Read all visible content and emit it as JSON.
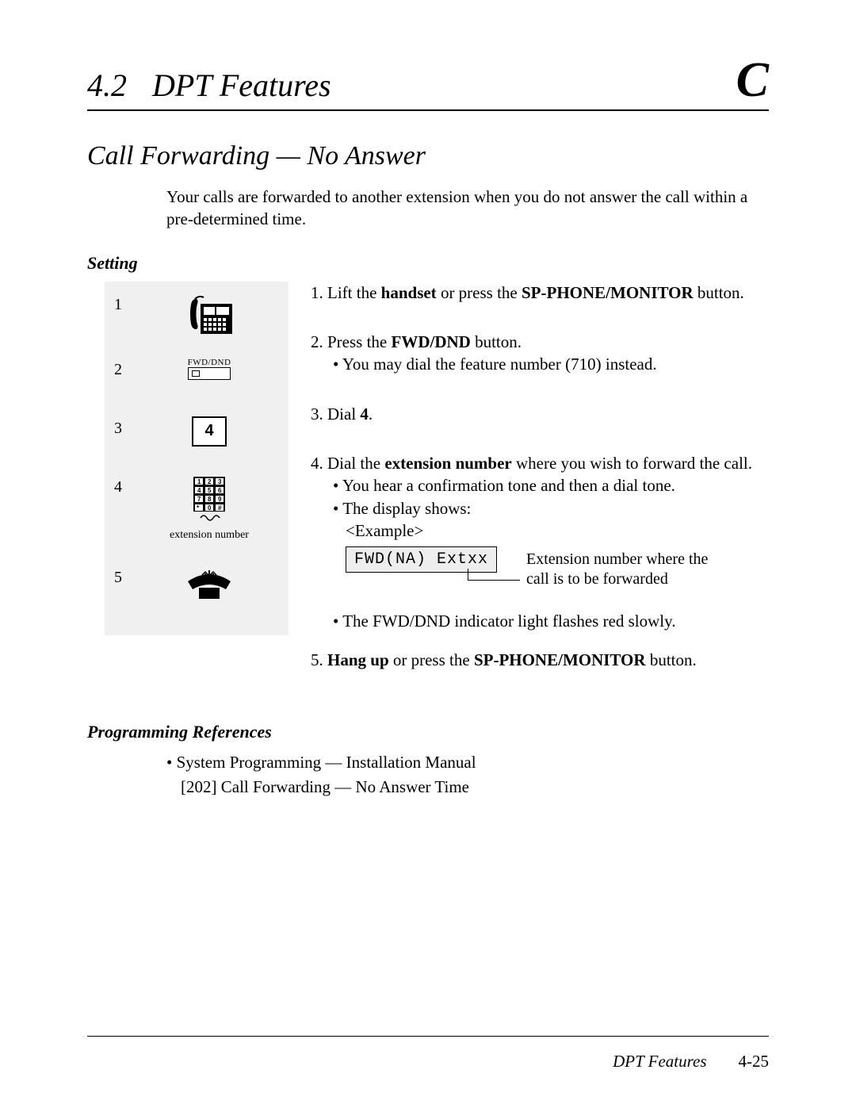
{
  "header": {
    "section_number": "4.2",
    "section_title": "DPT Features",
    "corner_letter": "C"
  },
  "feature_title": "Call Forwarding — No Answer",
  "intro": "Your calls are forwarded to another extension when you do not answer the call within a pre-determined time.",
  "setting_label": "Setting",
  "icons": {
    "r1": "1",
    "r2": "2",
    "r3": "3",
    "r4": "4",
    "r5": "5",
    "fwd_dnd_label": "FWD/DND",
    "key4": "4",
    "ext_caption": "extension number"
  },
  "steps": {
    "s1_a": "1.  Lift the ",
    "s1_b": "handset",
    "s1_c": " or press the ",
    "s1_d": "SP-PHONE/MONITOR",
    "s1_e": " button.",
    "s2_a": "2.  Press the ",
    "s2_b": "FWD/DND",
    "s2_c": " button.",
    "s2_sub": "•  You may dial the feature number (710) instead.",
    "s3_a": "3.  Dial ",
    "s3_b": "4",
    "s3_c": ".",
    "s4_a": "4.  Dial the ",
    "s4_b": "extension number",
    "s4_c": " where you wish to forward the call.",
    "s4_sub1": "•  You hear a confirmation tone and then a dial tone.",
    "s4_sub2": "•  The display shows:",
    "s4_sub2b": "<Example>",
    "display_text": "FWD(NA)  Extxx",
    "lead_text_1": "Extension number where the",
    "lead_text_2": "call is to be forwarded",
    "s4_sub3": "•  The FWD/DND indicator light flashes red slowly.",
    "s5_a": "5.  ",
    "s5_b": "Hang up",
    "s5_c": " or press the ",
    "s5_d": "SP-PHONE/MONITOR",
    "s5_e": " button."
  },
  "refs": {
    "heading": "Programming References",
    "line1": "•  System Programming — Installation Manual",
    "line2": "[202]  Call Forwarding — No Answer Time"
  },
  "footer": {
    "title": "DPT Features",
    "page": "4-25"
  }
}
